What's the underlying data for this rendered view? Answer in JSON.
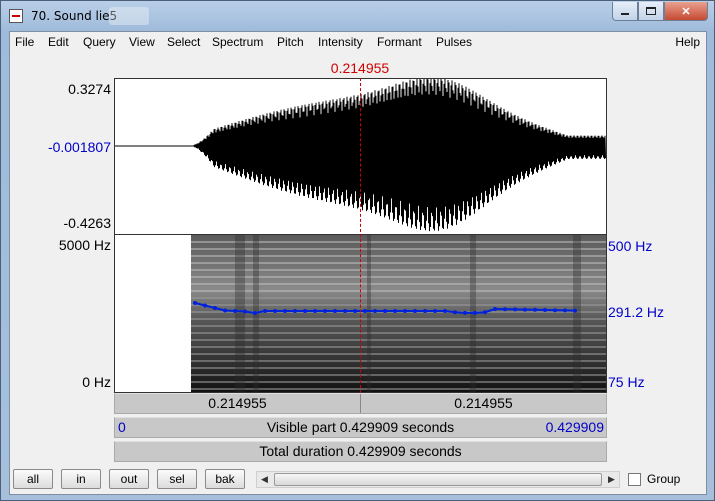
{
  "window": {
    "title": "70. Sound lie5",
    "help_label": "Help"
  },
  "menu": [
    "File",
    "Edit",
    "Query",
    "View",
    "Select",
    "Spectrum",
    "Pitch",
    "Intensity",
    "Formant",
    "Pulses"
  ],
  "cursor_time": "0.214955",
  "waveform": {
    "y_max": "0.3274",
    "y_cursor": "-0.001807",
    "y_min": "-0.4263"
  },
  "spectrogram": {
    "freq_max": "5000 Hz",
    "freq_min": "0 Hz",
    "pitch_max": "500 Hz",
    "pitch_current": "291.2 Hz",
    "pitch_min": "75 Hz"
  },
  "time_bar": {
    "left_value": "0.214955",
    "right_value": "0.214955"
  },
  "visible_bar": {
    "start": "0",
    "label": "Visible part 0.429909 seconds",
    "end": "0.429909"
  },
  "total_bar": {
    "label": "Total duration 0.429909 seconds"
  },
  "buttons": {
    "all": "all",
    "in": "in",
    "out": "out",
    "sel": "sel",
    "bak": "bak"
  },
  "group": {
    "label": "Group",
    "checked": false
  },
  "colors": {
    "cursor": "#d00000",
    "pitch_line": "#0022dd",
    "axis_blue": "#0000c8"
  }
}
